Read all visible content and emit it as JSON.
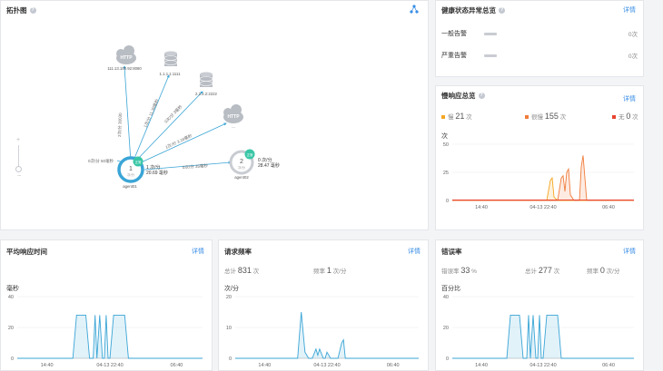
{
  "topology": {
    "title": "拓扑图",
    "nodes": [
      {
        "label": "HTTP",
        "sub": "111.13.100.92:8080"
      },
      {
        "label": "",
        "sub": "1.1.1.1:1111"
      },
      {
        "label": "",
        "sub": "2.2.2.2:2222"
      },
      {
        "label": "HTTP",
        "sub": "..."
      }
    ],
    "agent1": {
      "num": "1",
      "unit": "次/分",
      "badge": "正常",
      "name": "agent01",
      "calls": "1 次/分",
      "time": "20.69 毫秒"
    },
    "agent2": {
      "num": "2",
      "unit": "次/分",
      "badge": "正常",
      "name": "agent02",
      "calls": "0 次/分",
      "time": "28.47 毫秒"
    },
    "edges": [
      "2次/分 30030",
      "1次/分 11.39毫秒",
      "0次/分 3毫秒",
      "1次/分 3.18毫秒",
      "0次/分 50毫秒",
      "0次/分 35毫秒"
    ]
  },
  "health": {
    "title": "健康状态异常总览",
    "detail": "详情",
    "rows": [
      {
        "label": "一般告警",
        "value": "0次"
      },
      {
        "label": "严重告警",
        "value": "0次"
      }
    ]
  },
  "slow": {
    "title": "慢响应总览",
    "detail": "详情",
    "legend": [
      {
        "name": "慢",
        "value": "21",
        "unit": "次",
        "color": "#f5a623"
      },
      {
        "name": "很慢",
        "value": "155",
        "unit": "次",
        "color": "#f07c3a"
      },
      {
        "name": "无",
        "value": "0",
        "unit": "次",
        "color": "#e8442f"
      }
    ],
    "ylabel": "次",
    "chart_data": {
      "type": "area",
      "ylim": [
        0,
        50
      ],
      "yticks": [
        "50",
        "25",
        "0"
      ],
      "xticks": [
        "14:40",
        "04-13 22:40",
        "06:40"
      ],
      "series": [
        {
          "color": "#f5a623",
          "x": [
            0.0,
            0.52,
            0.54,
            0.55,
            0.56,
            0.58,
            1.0
          ],
          "values": [
            0,
            0,
            18,
            20,
            3,
            0,
            0
          ]
        },
        {
          "color": "#f07c3a",
          "x": [
            0.0,
            0.58,
            0.6,
            0.61,
            0.62,
            0.63,
            0.64,
            0.65,
            0.67,
            0.7,
            0.71,
            0.72,
            0.74,
            1.0
          ],
          "values": [
            0,
            0,
            20,
            22,
            8,
            25,
            28,
            5,
            0,
            0,
            30,
            40,
            0,
            0
          ]
        }
      ]
    }
  },
  "avg": {
    "title": "平均响应时间",
    "detail": "详情",
    "ylabel": "毫秒",
    "chart_data": {
      "type": "area",
      "ylim": [
        0,
        40
      ],
      "yticks": [
        "40",
        "20",
        "0"
      ],
      "xticks": [
        "14:40",
        "04-13 22:40",
        "06:40"
      ],
      "series": [
        {
          "color": "#3aa5d6",
          "x": [
            0.0,
            0.3,
            0.32,
            0.37,
            0.39,
            0.41,
            0.42,
            0.43,
            0.445,
            0.46,
            0.47,
            0.48,
            0.49,
            0.5,
            0.52,
            0.58,
            0.6,
            1.0
          ],
          "values": [
            0,
            0,
            28,
            28,
            0,
            0,
            28,
            0,
            28,
            0,
            0,
            28,
            0,
            0,
            28,
            28,
            0,
            0
          ]
        }
      ]
    }
  },
  "req": {
    "title": "请求频率",
    "detail": "详情",
    "total_label": "总计",
    "total_value": "831",
    "total_unit": "次",
    "rate_label": "频率",
    "rate_value": "1",
    "rate_unit": "次/分",
    "ylabel": "次/分",
    "chart_data": {
      "type": "area",
      "ylim": [
        0,
        20
      ],
      "yticks": [
        "20",
        "10",
        "0"
      ],
      "xticks": [
        "14:40",
        "04-13 22:40",
        "06:40"
      ],
      "series": [
        {
          "color": "#3aa5d6",
          "x": [
            0.0,
            0.34,
            0.36,
            0.38,
            0.4,
            0.42,
            0.44,
            0.45,
            0.46,
            0.48,
            0.49,
            0.5,
            0.52,
            0.56,
            0.58,
            0.59,
            0.6,
            1.0
          ],
          "values": [
            0,
            0,
            15,
            2,
            0,
            0,
            3,
            1,
            3,
            0,
            0,
            2,
            0,
            0,
            5,
            6,
            0,
            0
          ]
        }
      ]
    }
  },
  "err": {
    "title": "错误率",
    "detail": "详情",
    "rate_label": "错误率",
    "rate_value": "33",
    "rate_unit": "%",
    "total_label": "总计",
    "total_value": "277",
    "total_unit": "次",
    "freq_label": "频率",
    "freq_value": "0",
    "freq_unit": "次/分",
    "ylabel": "百分比",
    "chart_data": {
      "type": "area",
      "ylim": [
        0,
        40
      ],
      "yticks": [
        "40",
        "20",
        "0"
      ],
      "xticks": [
        "14:40",
        "04-13 22:40",
        "06:40"
      ],
      "series": [
        {
          "color": "#3aa5d6",
          "x": [
            0.0,
            0.3,
            0.32,
            0.37,
            0.39,
            0.41,
            0.42,
            0.43,
            0.445,
            0.46,
            0.47,
            0.48,
            0.49,
            0.5,
            0.52,
            0.58,
            0.6,
            1.0
          ],
          "values": [
            0,
            0,
            28,
            28,
            0,
            0,
            28,
            0,
            28,
            0,
            0,
            28,
            0,
            0,
            28,
            28,
            0,
            0
          ]
        }
      ]
    }
  }
}
